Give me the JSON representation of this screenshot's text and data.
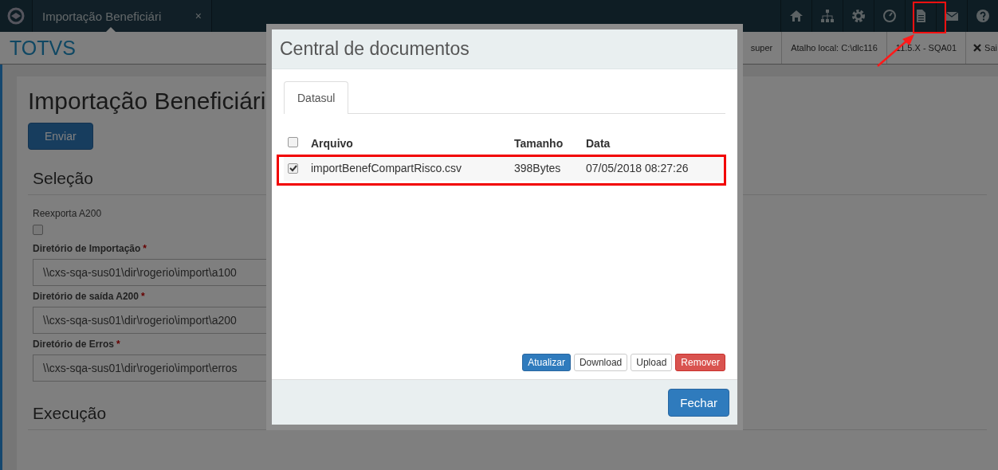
{
  "top_bar": {
    "tab": {
      "label": "Importação Beneficiári",
      "close": "×",
      "selected": true
    }
  },
  "sub_header": {
    "brand": "TOTVS",
    "items": [
      "super",
      "Atalho local: C:\\dlc116",
      "11.5.X - SQA01"
    ],
    "logout": "Sai"
  },
  "page": {
    "title": "Importação Beneficiári",
    "submit": "Enviar",
    "sections": [
      {
        "title": "Seleção",
        "fields": [
          {
            "kind": "checkbox",
            "label": "Reexporta A200",
            "checked": false
          },
          {
            "kind": "text",
            "label": "Diretório de Importação",
            "required_mark": "*",
            "value": "\\\\cxs-sqa-sus01\\dir\\rogerio\\import\\a100"
          },
          {
            "kind": "text",
            "label": "Diretório de saída A200",
            "required_mark": "*",
            "value": "\\\\cxs-sqa-sus01\\dir\\rogerio\\import\\a200"
          },
          {
            "kind": "text",
            "label": "Diretório de Erros",
            "required_mark": "*",
            "value": "\\\\cxs-sqa-sus01\\dir\\rogerio\\import\\erros"
          }
        ]
      },
      {
        "title": "Execução"
      }
    ]
  },
  "dialog": {
    "title": "Central de documentos",
    "tabs": [
      {
        "label": "Datasul",
        "selected": true
      }
    ],
    "table": {
      "select_all": {
        "checked": false
      },
      "columns": [
        "Arquivo",
        "Tamanho",
        "Data"
      ],
      "rows": [
        {
          "checked": true,
          "cells": [
            "importBenefCompartRisco.csv",
            "398Bytes",
            "07/05/2018 08:27:26"
          ]
        }
      ]
    },
    "actions": [
      {
        "label": "Atualizar",
        "kind": "primary"
      },
      {
        "label": "Download",
        "kind": "default"
      },
      {
        "label": "Upload",
        "kind": "default"
      },
      {
        "label": "Remover",
        "kind": "danger"
      }
    ],
    "close": "Fechar"
  }
}
